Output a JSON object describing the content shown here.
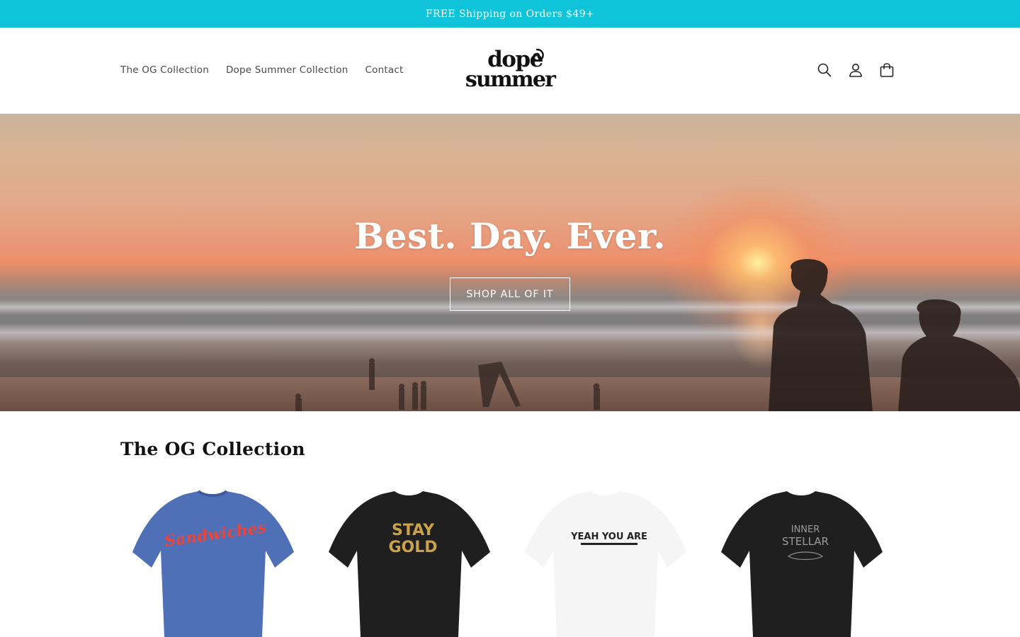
{
  "announcement": {
    "text": "FREE Shipping on Orders $49+"
  },
  "header": {
    "nav": [
      {
        "label": "The OG Collection"
      },
      {
        "label": "Dope Summer Collection"
      },
      {
        "label": "Contact"
      }
    ],
    "logo": {
      "line1": "dope",
      "line2": "summer"
    },
    "icons": [
      "search-icon",
      "account-icon",
      "cart-icon"
    ]
  },
  "hero": {
    "title": "Best. Day. Ever.",
    "button_label": "SHOP ALL OF IT"
  },
  "collection": {
    "title": "The OG Collection",
    "products": [
      {
        "shirt_color": "#4f6fb6",
        "graphic": "Sandwiches",
        "graphic_color": "#e8453e"
      },
      {
        "shirt_color": "#1f1f1f",
        "graphic": "STAY GOLD",
        "graphic_color": "#c9a24a"
      },
      {
        "shirt_color": "#f5f5f5",
        "graphic": "YEAH YOU ARE",
        "graphic_color": "#222222"
      },
      {
        "shirt_color": "#1f1f1f",
        "graphic": "INNER STELLAR",
        "graphic_color": "#9a9a9a"
      }
    ]
  },
  "colors": {
    "accent": "#0fc3d9",
    "text": "#121212"
  }
}
